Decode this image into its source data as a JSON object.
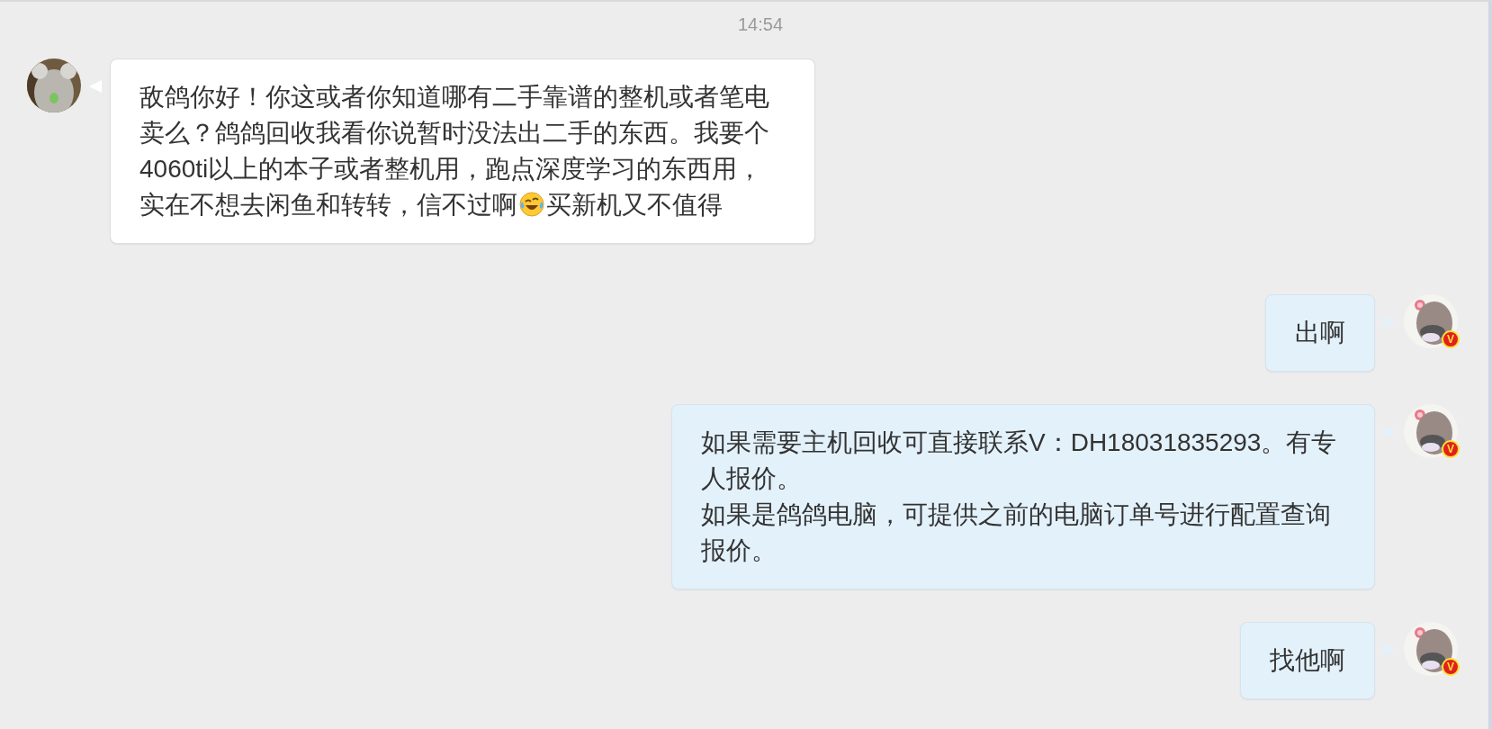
{
  "timestamp": "14:54",
  "messages": [
    {
      "kind": "incoming",
      "paragraphs": [
        [
          {
            "kind": "text",
            "text": "敌鸽你好！你这或者你知道哪有二手靠谱的整机或者笔电卖么？鸽鸽回收我看你说暂时没法出二手的东西。我要个4060ti以上的本子或者整机用，跑点深度学习的东西用，实在不想去闲鱼和转转，信不过啊"
          },
          {
            "kind": "emoji"
          },
          {
            "kind": "text",
            "text": "买新机又不值得"
          }
        ]
      ]
    },
    {
      "kind": "outgoing",
      "badge": "V",
      "paragraphs": [
        [
          {
            "kind": "text",
            "text": "出啊"
          }
        ]
      ]
    },
    {
      "kind": "outgoing",
      "badge": "V",
      "paragraphs": [
        [
          {
            "kind": "text",
            "text": "如果需要主机回收可直接联系V：DH18031835293。有专人报价。"
          }
        ],
        [
          {
            "kind": "text",
            "text": "如果是鸽鸽电脑，可提供之前的电脑订单号进行配置查询报价。"
          }
        ]
      ]
    },
    {
      "kind": "outgoing",
      "badge": "V",
      "paragraphs": [
        [
          {
            "kind": "text",
            "text": "找他啊"
          }
        ]
      ]
    }
  ]
}
